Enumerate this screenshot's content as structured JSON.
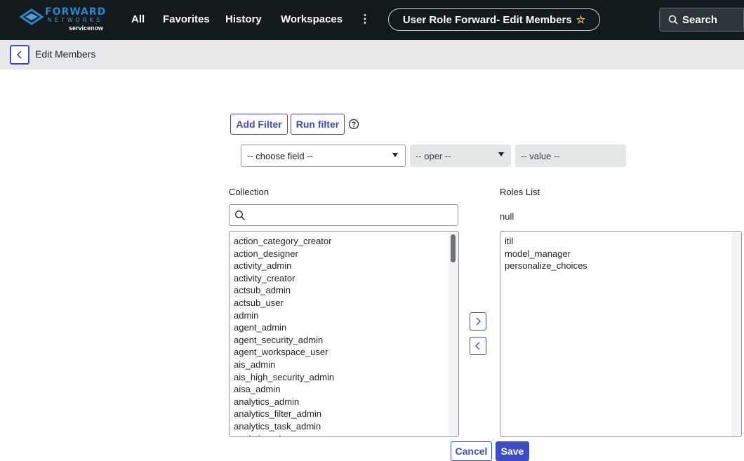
{
  "nav": {
    "logo": {
      "brand": "FORWARD",
      "sub": "NETWORKS",
      "powered": "servicenow"
    },
    "items": [
      "All",
      "Favorites",
      "History",
      "Workspaces"
    ],
    "more": "⋮",
    "context_title": "User Role Forward- Edit Members",
    "search_label": "Search"
  },
  "subheader": {
    "title": "Edit Members"
  },
  "filter": {
    "add_filter": "Add Filter",
    "run_filter": "Run filter",
    "field": "-- choose field --",
    "oper": "-- oper --",
    "value": "-- value --"
  },
  "collection": {
    "label": "Collection",
    "search_value": "",
    "items": [
      "action_category_creator",
      "action_designer",
      "activity_admin",
      "activity_creator",
      "actsub_admin",
      "actsub_user",
      "admin",
      "agent_admin",
      "agent_security_admin",
      "agent_workspace_user",
      "ais_admin",
      "ais_high_security_admin",
      "aisa_admin",
      "analytics_admin",
      "analytics_filter_admin",
      "analytics_task_admin",
      "analytics_viewer"
    ]
  },
  "roles": {
    "label": "Roles List",
    "null_text": "null",
    "items": [
      "itil",
      "model_manager",
      "personalize_choices"
    ]
  },
  "actions": {
    "cancel": "Cancel",
    "save": "Save"
  },
  "colors": {
    "nav_bg": "#121a1e",
    "accent": "#3e4cc2",
    "subheader_bg": "#e6e8ea"
  }
}
